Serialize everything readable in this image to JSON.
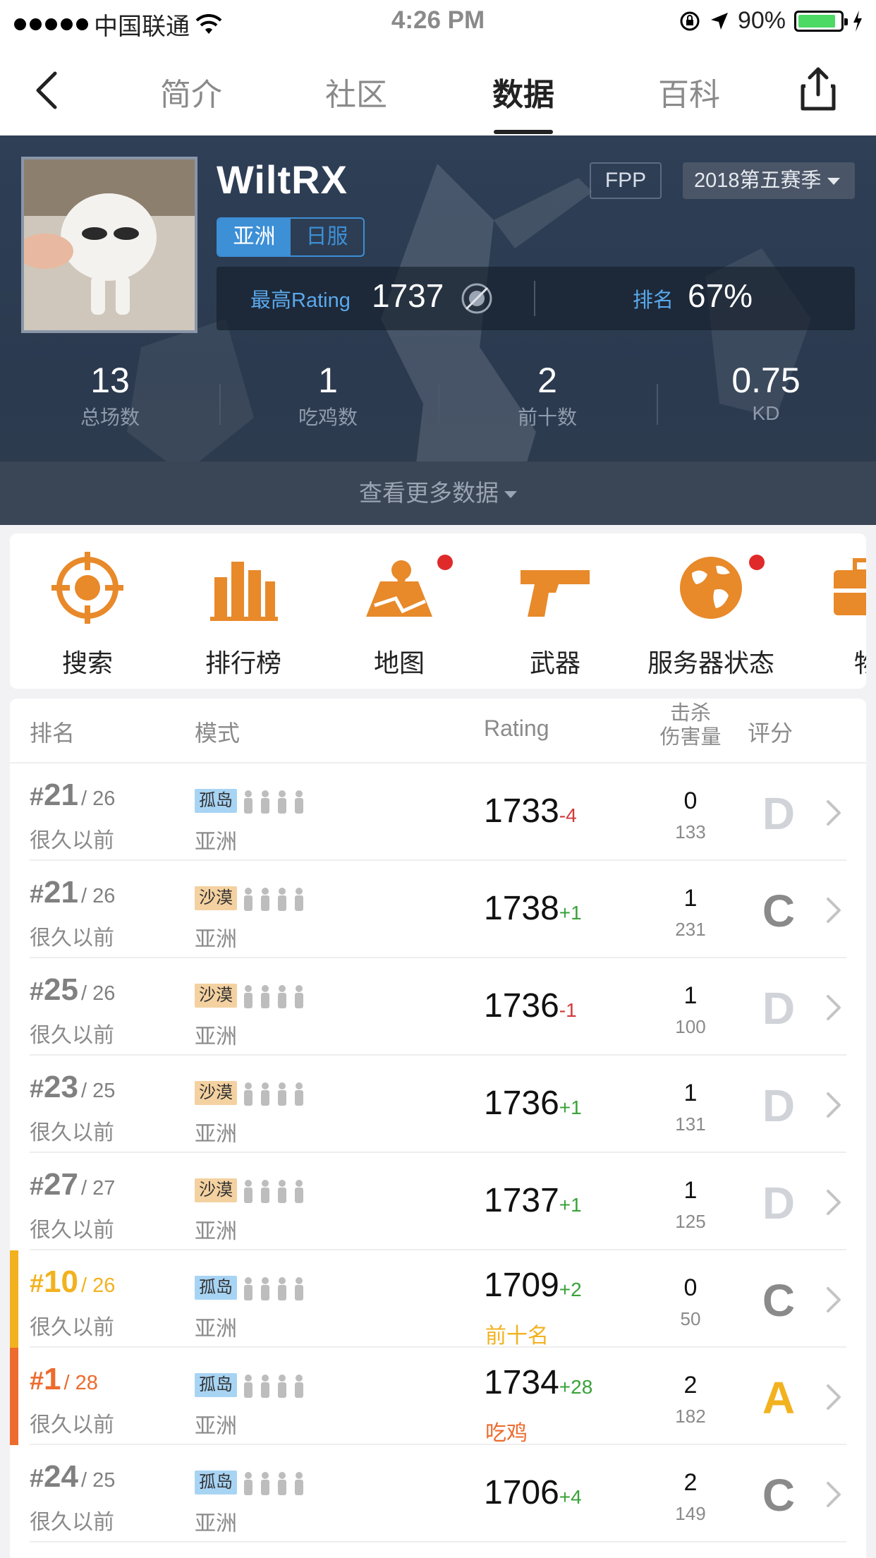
{
  "status_bar": {
    "carrier": "中国联通",
    "time": "4:26 PM",
    "battery": "90%",
    "battery_level": 0.9
  },
  "nav": {
    "tabs": [
      {
        "label": "简介",
        "active": false
      },
      {
        "label": "社区",
        "active": false
      },
      {
        "label": "数据",
        "active": true
      },
      {
        "label": "百科",
        "active": false
      }
    ]
  },
  "profile": {
    "username": "WiltRX",
    "mode_button": "FPP",
    "season_button": "2018第五赛季",
    "region_on": "亚洲",
    "region_off": "日服",
    "best_rating_label": "最高Rating",
    "best_rating_value": "1737",
    "rank_label": "排名",
    "rank_value": "67%",
    "stats": [
      {
        "num": "13",
        "label": "总场数"
      },
      {
        "num": "1",
        "label": "吃鸡数"
      },
      {
        "num": "2",
        "label": "前十数"
      },
      {
        "num": "0.75",
        "label": "KD"
      }
    ],
    "more_data": "查看更多数据"
  },
  "tools": [
    {
      "label": "搜索",
      "icon": "crosshair-icon",
      "badge": false
    },
    {
      "label": "排行榜",
      "icon": "leaderboard-icon",
      "badge": false
    },
    {
      "label": "地图",
      "icon": "map-icon",
      "badge": true
    },
    {
      "label": "武器",
      "icon": "pistol-icon",
      "badge": false
    },
    {
      "label": "服务器状态",
      "icon": "globe-icon",
      "badge": true
    },
    {
      "label": "物",
      "icon": "item-icon",
      "badge": false
    }
  ],
  "table": {
    "headers": {
      "rank": "排名",
      "mode": "模式",
      "rating": "Rating",
      "kills_line1": "击杀",
      "kills_line2": "伤害量",
      "grade": "评分"
    },
    "rows": [
      {
        "hash": "#",
        "rank": "21",
        "total": "/ 26",
        "time": "很久以前",
        "mode": "孤岛",
        "mode_type": "island",
        "region": "亚洲",
        "rating": "1733",
        "delta": "-4",
        "delta_sign": "neg",
        "tag": "",
        "kills": "0",
        "damage": "133",
        "grade": "D",
        "accent": ""
      },
      {
        "hash": "#",
        "rank": "21",
        "total": "/ 26",
        "time": "很久以前",
        "mode": "沙漠",
        "mode_type": "desert",
        "region": "亚洲",
        "rating": "1738",
        "delta": "+1",
        "delta_sign": "pos",
        "tag": "",
        "kills": "1",
        "damage": "231",
        "grade": "C",
        "accent": ""
      },
      {
        "hash": "#",
        "rank": "25",
        "total": "/ 26",
        "time": "很久以前",
        "mode": "沙漠",
        "mode_type": "desert",
        "region": "亚洲",
        "rating": "1736",
        "delta": "-1",
        "delta_sign": "neg",
        "tag": "",
        "kills": "1",
        "damage": "100",
        "grade": "D",
        "accent": ""
      },
      {
        "hash": "#",
        "rank": "23",
        "total": "/ 25",
        "time": "很久以前",
        "mode": "沙漠",
        "mode_type": "desert",
        "region": "亚洲",
        "rating": "1736",
        "delta": "+1",
        "delta_sign": "pos",
        "tag": "",
        "kills": "1",
        "damage": "131",
        "grade": "D",
        "accent": ""
      },
      {
        "hash": "#",
        "rank": "27",
        "total": "/ 27",
        "time": "很久以前",
        "mode": "沙漠",
        "mode_type": "desert",
        "region": "亚洲",
        "rating": "1737",
        "delta": "+1",
        "delta_sign": "pos",
        "tag": "",
        "kills": "1",
        "damage": "125",
        "grade": "D",
        "accent": ""
      },
      {
        "hash": "#",
        "rank": "10",
        "total": "/ 26",
        "time": "很久以前",
        "mode": "孤岛",
        "mode_type": "island",
        "region": "亚洲",
        "rating": "1709",
        "delta": "+2",
        "delta_sign": "pos",
        "tag": "前十名",
        "kills": "0",
        "damage": "50",
        "grade": "C",
        "accent": "top10"
      },
      {
        "hash": "#",
        "rank": "1",
        "total": "/ 28",
        "time": "很久以前",
        "mode": "孤岛",
        "mode_type": "island",
        "region": "亚洲",
        "rating": "1734",
        "delta": "+28",
        "delta_sign": "pos",
        "tag": "吃鸡",
        "kills": "2",
        "damage": "182",
        "grade": "A",
        "accent": "win"
      },
      {
        "hash": "#",
        "rank": "24",
        "total": "/ 25",
        "time": "很久以前",
        "mode": "孤岛",
        "mode_type": "island",
        "region": "亚洲",
        "rating": "1706",
        "delta": "+4",
        "delta_sign": "pos",
        "tag": "",
        "kills": "2",
        "damage": "149",
        "grade": "C",
        "accent": ""
      }
    ]
  },
  "colors": {
    "grade_D": "#d0d3d8",
    "grade_C": "#8a8a8a",
    "grade_A": "#f2b21f",
    "top10": "#f2b21f",
    "win": "#ec6b2d",
    "tool_orange": "#e8892a"
  }
}
